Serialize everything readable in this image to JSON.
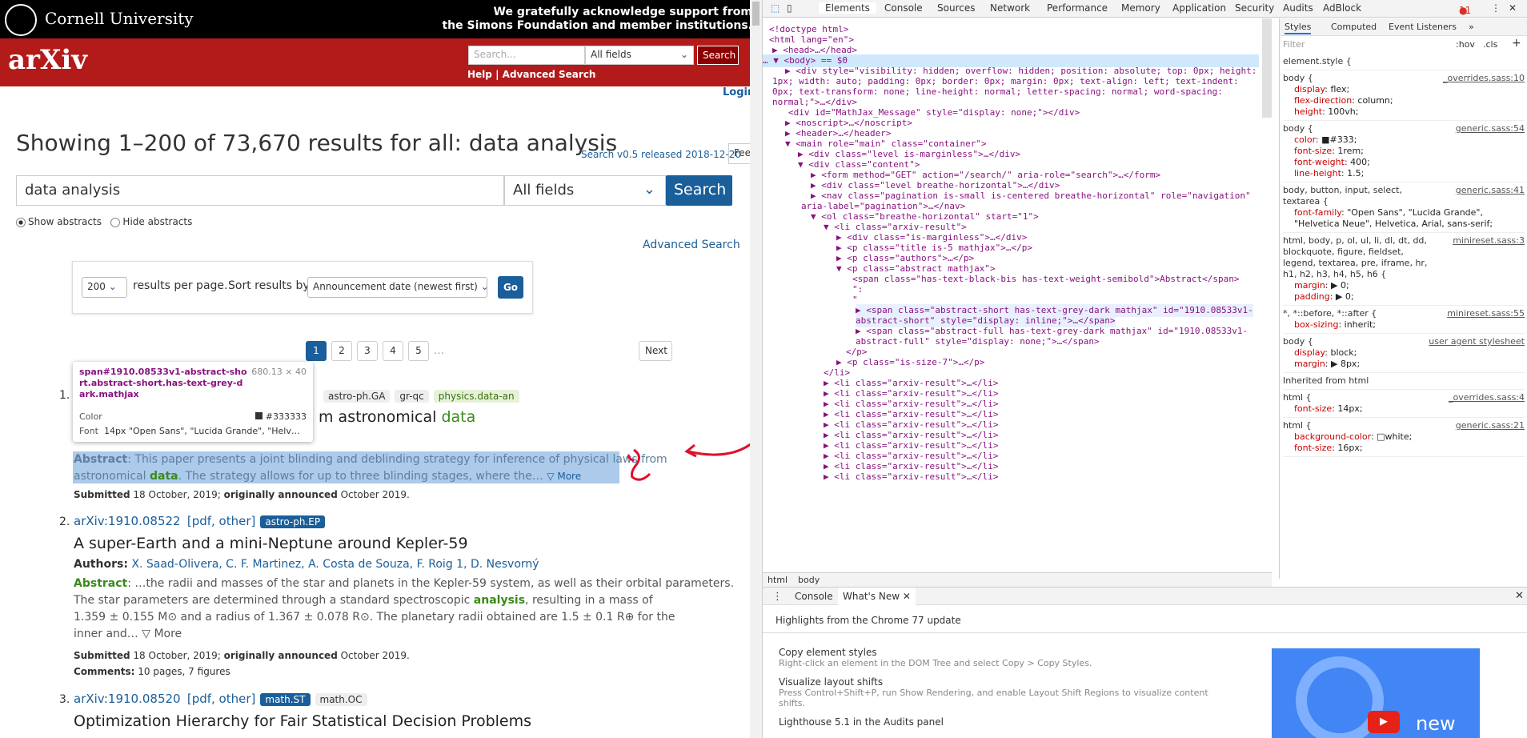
{
  "cornell": {
    "name": "Cornell University",
    "ack_line1": "We gratefully acknowledge support from",
    "ack_line2": "the Simons Foundation and member institutions."
  },
  "arxiv": {
    "brand": "arXiv",
    "search_placeholder": "Search...",
    "fields_value": "All fields",
    "search_btn": "Search",
    "help": "Help",
    "sep": "|",
    "adv": "Advanced Search",
    "login": "Login"
  },
  "results": {
    "title": "Showing 1–200 of 73,670 results for all: data analysis",
    "search_version": "Search v0.5 released 2018-12-20",
    "feedback": "Feedback?",
    "query": "data analysis",
    "fields": "All fields",
    "search_btn": "Search",
    "show_abstracts": "Show abstracts",
    "hide_abstracts": "Hide abstracts",
    "advanced": "Advanced Search",
    "per_page": "200",
    "per_page_label": "results per page.",
    "sort_label": "Sort results by",
    "sort_value": "Announcement date (newest first)",
    "go": "Go",
    "pages": [
      "1",
      "2",
      "3",
      "4",
      "5"
    ],
    "ellipsis": "…",
    "next": "Next"
  },
  "tooltip": {
    "selector": "span#1910.08533v1-abstract-short.abstract-short.has-text-grey-dark.mathjax",
    "size": "680.13 × 40",
    "color_label": "Color",
    "color_value": "#333333",
    "font_label": "Font",
    "font_value": "14px \"Open Sans\", \"Lucida Grande\", \"Helv…"
  },
  "items": [
    {
      "num": "1.",
      "tags": [
        "astro-ph.GA",
        "gr-qc",
        "physics.data-an"
      ],
      "title_end": "m astronomical",
      "title_kw": "data",
      "abs_label": "Abstract",
      "abs_line1": ": This paper presents a joint blinding and deblinding strategy for inference of physical laws from",
      "abs_line2a": "astronomical ",
      "abs_kw": "data",
      "abs_line2b": ". The strategy allows for up to three blinding stages, where the…",
      "more": "▽ More",
      "submitted": "Submitted",
      "sub_date": "18 October, 2019;",
      "orig": "originally announced",
      "orig_date": "October 2019."
    },
    {
      "num": "2.",
      "id": "arXiv:1910.08522",
      "links": "[pdf, other]",
      "tag": "astro-ph.EP",
      "title": "A super-Earth and a mini-Neptune around Kepler-59",
      "authors_label": "Authors:",
      "authors": "X. Saad-Olivera, C. F. Martinez, A. Costa de Souza, F. Roig 1, D. Nesvorný",
      "abs_label": "Abstract",
      "abs_l1": ": …the radii and masses of the star and planets in the Kepler-59 system, as well as their orbital parameters.",
      "abs_l2a": "The star parameters are determined through a standard spectroscopic ",
      "abs_kw": "analysis",
      "abs_l2b": ", resulting in a mass of",
      "abs_l3": "1.359 ± 0.155 M⊙ and a radius of 1.367 ± 0.078 R⊙. The planetary radii obtained are 1.5 ± 0.1 R⊕ for the",
      "abs_l4": "inner and… ▽ More",
      "submitted": "Submitted",
      "sub_date": "18 October, 2019;",
      "orig": "originally announced",
      "orig_date": "October 2019.",
      "comments_label": "Comments:",
      "comments": "10 pages, 7 figures"
    },
    {
      "num": "3.",
      "id": "arXiv:1910.08520",
      "links": "[pdf, other]",
      "tag1": "math.ST",
      "tag2": "math.OC",
      "title": "Optimization Hierarchy for Fair Statistical Decision Problems"
    }
  ],
  "devtools": {
    "tabs": [
      "Elements",
      "Console",
      "Sources",
      "Network",
      "Performance",
      "Memory",
      "Application",
      "Security",
      "Audits",
      "AdBlock"
    ],
    "errors": "11",
    "tree": [
      "<!doctype html>",
      "<html lang=\"en\">",
      "▶ <head>…</head>",
      "… ▼ <body> == $0",
      "▶ <div style=\"visibility: hidden; overflow: hidden; position: absolute; top: 0px; height:",
      "1px; width: auto; padding: 0px; border: 0px; margin: 0px; text-align: left; text-indent:",
      "0px; text-transform: none; line-height: normal; letter-spacing: normal; word-spacing:",
      "normal;\">…</div>",
      "<div id=\"MathJax_Message\" style=\"display: none;\"></div>",
      "▶ <noscript>…</noscript>",
      "▶ <header>…</header>",
      "▼ <main role=\"main\" class=\"container\">",
      "▶ <div class=\"level is-marginless\">…</div>",
      "▼ <div class=\"content\">",
      "▶ <form method=\"GET\" action=\"/search/\" aria-role=\"search\">…</form>",
      "▶ <div class=\"level breathe-horizontal\">…</div>",
      "▶ <nav class=\"pagination is-small is-centered breathe-horizontal\" role=\"navigation\"",
      "aria-label=\"pagination\">…</nav>",
      "▼ <ol class=\"breathe-horizontal\" start=\"1\">",
      "▼ <li class=\"arxiv-result\">",
      "▶ <div class=\"is-marginless\">…</div>",
      "▶ <p class=\"title is-5 mathjax\">…</p>",
      "▶ <p class=\"authors\">…</p>",
      "▼ <p class=\"abstract mathjax\">",
      "<span class=\"has-text-black-bis has-text-weight-semibold\">Abstract</span>",
      "\":",
      "\"",
      "▶ <span class=\"abstract-short has-text-grey-dark mathjax\" id=\"1910.08533v1-",
      "abstract-short\" style=\"display: inline;\">…</span>",
      "▶ <span class=\"abstract-full has-text-grey-dark mathjax\" id=\"1910.08533v1-",
      "abstract-full\" style=\"display: none;\">…</span>",
      "</p>",
      "▶ <p class=\"is-size-7\">…</p>",
      "</li>",
      "▶ <li class=\"arxiv-result\">…</li>",
      "▶ <li class=\"arxiv-result\">…</li>",
      "▶ <li class=\"arxiv-result\">…</li>",
      "▶ <li class=\"arxiv-result\">…</li>",
      "▶ <li class=\"arxiv-result\">…</li>",
      "▶ <li class=\"arxiv-result\">…</li>",
      "▶ <li class=\"arxiv-result\">…</li>",
      "▶ <li class=\"arxiv-result\">…</li>",
      "▶ <li class=\"arxiv-result\">…</li>",
      "▶ <li class=\"arxiv-result\">…</li>"
    ],
    "crumbs": [
      "html",
      "body"
    ],
    "style_tabs": [
      "Styles",
      "Computed",
      "Event Listeners",
      "»"
    ],
    "filter": "Filter",
    "hov": ":hov",
    "cls": ".cls",
    "plus": "+",
    "rules": [
      {
        "sel": "element.style {",
        "src": "",
        "props": []
      },
      {
        "sel": "body {",
        "src": "_overrides.sass:10",
        "props": [
          [
            "display",
            "flex;"
          ],
          [
            "flex-direction",
            "column;"
          ],
          [
            "height",
            "100vh;"
          ]
        ]
      },
      {
        "sel": "body {",
        "src": "generic.sass:54",
        "props": [
          [
            "color",
            "■#333;"
          ],
          [
            "font-size",
            "1rem;"
          ],
          [
            "font-weight",
            "400;"
          ],
          [
            "line-height",
            "1.5;"
          ]
        ]
      },
      {
        "sel": "body, button, input, select, textarea {",
        "src": "generic.sass:41",
        "props": [
          [
            "font-family",
            "\"Open Sans\", \"Lucida Grande\", \"Helvetica Neue\", Helvetica, Arial, sans-serif;"
          ]
        ]
      },
      {
        "sel": "html, body, p, ol, ul, li, dl, dt, dd, blockquote, figure, fieldset, legend, textarea, pre, iframe, hr, h1, h2, h3, h4, h5, h6 {",
        "src": "minireset.sass:3",
        "props": [
          [
            "margin",
            "▶ 0;"
          ],
          [
            "padding",
            "▶ 0;"
          ]
        ]
      },
      {
        "sel": "*, *::before, *::after {",
        "src": "minireset.sass:55",
        "props": [
          [
            "box-sizing",
            "inherit;"
          ]
        ]
      },
      {
        "sel": "body {",
        "src": "user agent stylesheet",
        "props": [
          [
            "display",
            "block;"
          ],
          [
            "margin",
            "▶ 8px;"
          ]
        ]
      },
      {
        "sel": "Inherited from html",
        "src": "",
        "props": []
      },
      {
        "sel": "html {",
        "src": "_overrides.sass:4",
        "props": [
          [
            "font-size",
            "14px;"
          ]
        ]
      },
      {
        "sel": "html {",
        "src": "generic.sass:21",
        "props": [
          [
            "background-color",
            "□white;"
          ],
          [
            "font-size",
            "16px;"
          ]
        ]
      }
    ],
    "drawer_tabs": [
      "Console",
      "What's New"
    ],
    "whatsnew_title": "Highlights from the Chrome 77 update",
    "news": [
      {
        "h": "Copy element styles",
        "p": "Right-click an element in the DOM Tree and select Copy > Copy Styles."
      },
      {
        "h": "Visualize layout shifts",
        "p": "Press Control+Shift+P, run Show Rendering, and enable Layout Shift Regions to visualize content shifts."
      },
      {
        "h": "Lighthouse 5.1 in the Audits panel",
        "p": ""
      }
    ],
    "promo_text": "new"
  }
}
